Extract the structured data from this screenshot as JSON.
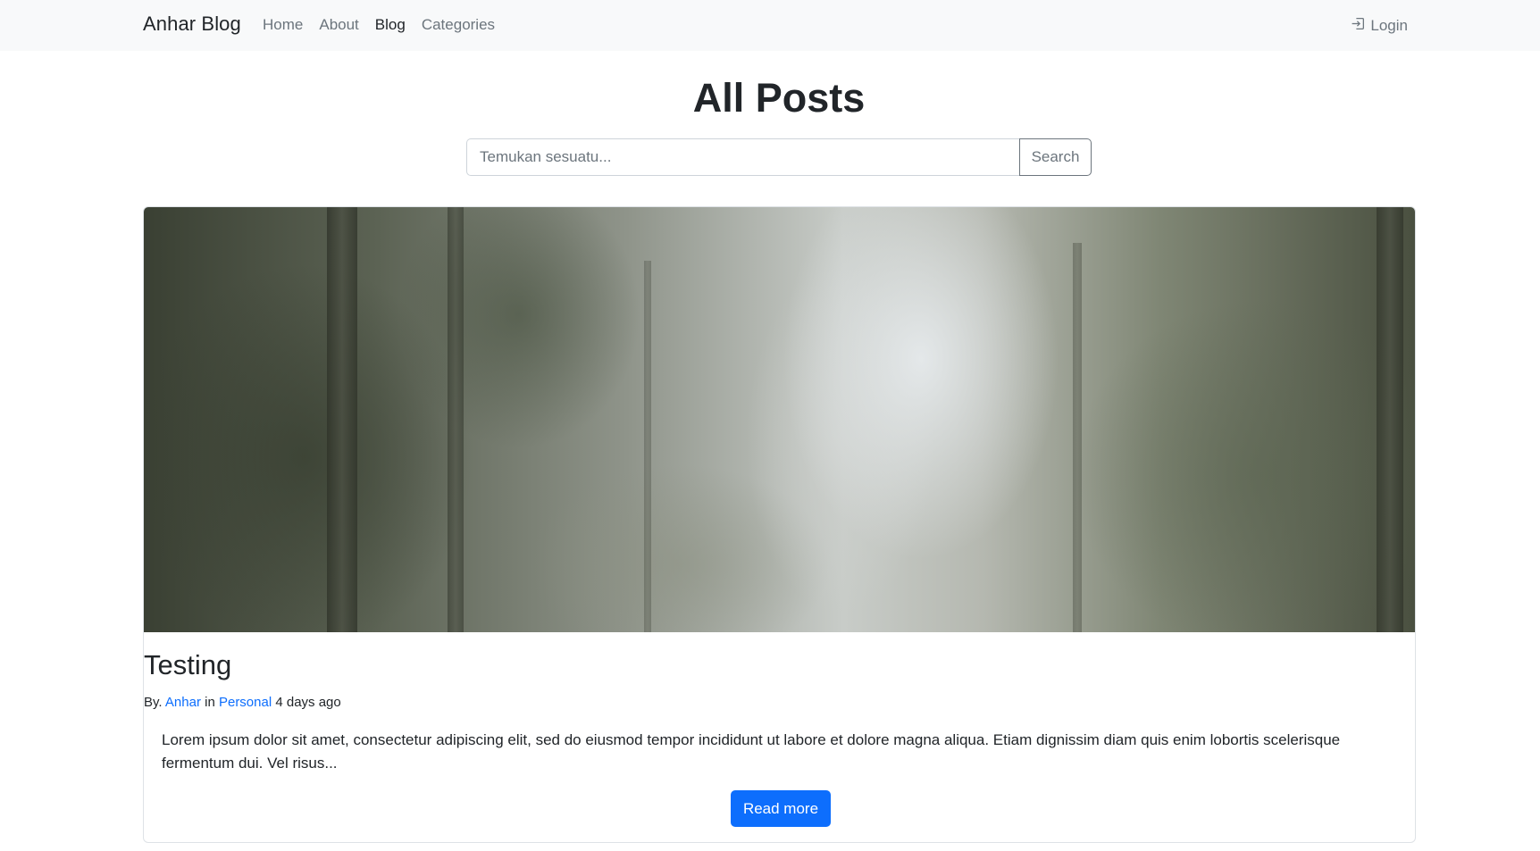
{
  "navbar": {
    "brand": "Anhar Blog",
    "links": [
      {
        "label": "Home",
        "active": false
      },
      {
        "label": "About",
        "active": false
      },
      {
        "label": "Blog",
        "active": true
      },
      {
        "label": "Categories",
        "active": false
      }
    ],
    "login_label": "Login",
    "login_icon": "login-icon"
  },
  "page": {
    "title": "All Posts"
  },
  "search": {
    "placeholder": "Temukan sesuatu...",
    "button_label": "Search"
  },
  "post": {
    "image_alt": "forest",
    "title": "Testing",
    "by_prefix": "By.",
    "author": "Anhar",
    "in_word": "in",
    "category": "Personal",
    "time_ago": "4 days ago",
    "excerpt": "Lorem ipsum dolor sit amet, consectetur adipiscing elit, sed do eiusmod tempor incididunt ut labore et dolore magna aliqua. Etiam dignissim diam quis enim lobortis scelerisque fermentum dui. Vel risus...",
    "read_more_label": "Read more"
  },
  "colors": {
    "navbar_bg": "#f8f9fa",
    "link_blue": "#0d6efd",
    "muted": "#6c757d",
    "text": "#212529"
  }
}
